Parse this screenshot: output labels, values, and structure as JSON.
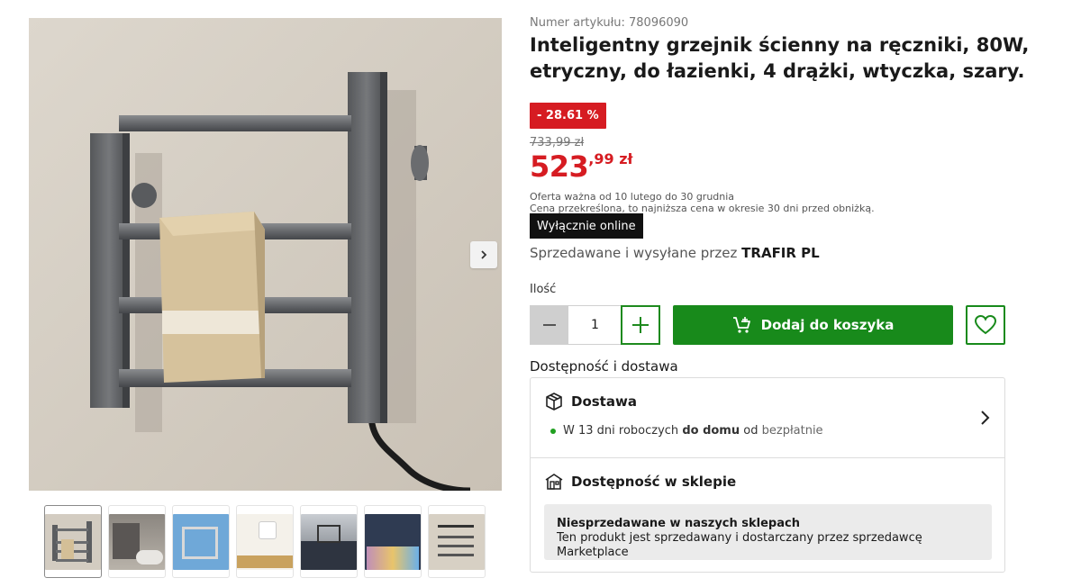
{
  "product": {
    "article_number": "Numer artykułu: 78096090",
    "title": "Inteligentny grzejnik ścienny na ręczniki, 80W, etryczny, do łazienki, 4 drążki, wtyczka, szary.",
    "discount": "- 28.61 %",
    "old_price": "733,99 zł",
    "price_main": "523",
    "price_fraction": ",99 zł",
    "offer_line1": "Oferta ważna od 10 lutego do 30 grudnia",
    "offer_line2": "Cena przekreślona, to najniższa cena w okresie 30 dni przed obniżką.",
    "online_badge": "Wyłącznie online",
    "seller_prefix": "Sprzedawane i wysyłane przez",
    "seller_name": "TRAFIR PL"
  },
  "quantity": {
    "label": "Ilość",
    "value": "1"
  },
  "actions": {
    "add_to_cart": "Dodaj do koszyka"
  },
  "availability": {
    "section_title": "Dostępność i dostawa",
    "delivery_title": "Dostawa",
    "delivery_prefix": "W 13 dni roboczych",
    "delivery_bold": "do domu",
    "delivery_mid": "od",
    "delivery_cost": "bezpłatnie",
    "store_title": "Dostępność w sklepie",
    "store_note_title": "Niesprzedawane w naszych sklepach",
    "store_note_text": "Ten produkt jest sprzedawany i dostarczany przez sprzedawcę Marketplace"
  },
  "gallery": {
    "thumbnails": [
      "thumb-1",
      "thumb-2",
      "thumb-3",
      "thumb-4",
      "thumb-5",
      "thumb-6",
      "thumb-7"
    ],
    "active_index": 0
  },
  "colors": {
    "accent_green": "#188a1b",
    "price_red": "#d61c22"
  },
  "icons": {
    "next": "chevron-right-icon",
    "minus": "minus-icon",
    "plus": "plus-icon",
    "cart": "cart-plus-icon",
    "wishlist": "heart-icon",
    "delivery": "box-icon",
    "store": "store-icon",
    "delivery_expand": "chevron-right-icon"
  }
}
